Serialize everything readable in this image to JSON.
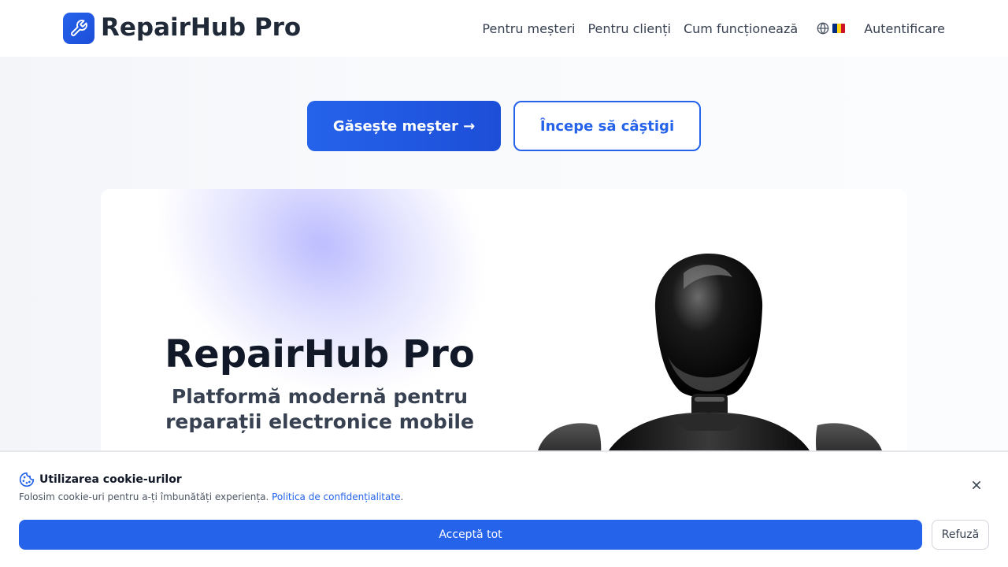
{
  "header": {
    "brand": "RepairHub Pro",
    "nav": [
      {
        "label": "Pentru meșteri"
      },
      {
        "label": "Pentru clienți"
      },
      {
        "label": "Cum funcționează"
      }
    ],
    "language_icon": "globe-icon",
    "language_flag_colors": [
      "#002B7F",
      "#FCD116",
      "#CE1126"
    ],
    "login": "Autentificare"
  },
  "hero": {
    "primary_button": "Găsește meșter →",
    "secondary_button": "Începe să câștigi",
    "title": "RepairHub Pro",
    "subtitle": "Platformă modernă pentru reparații electronice mobile"
  },
  "cookie_banner": {
    "title": "Utilizarea cookie-urilor",
    "text": "Folosim cookie-uri pentru a-ți îmbunătăți experiența. ",
    "link": "Politica de confidențialitate",
    "period": ".",
    "accept": "Acceptă tot",
    "refuse": "Refuză"
  },
  "colors": {
    "accent": "#2563eb",
    "text_dark": "#111827"
  }
}
